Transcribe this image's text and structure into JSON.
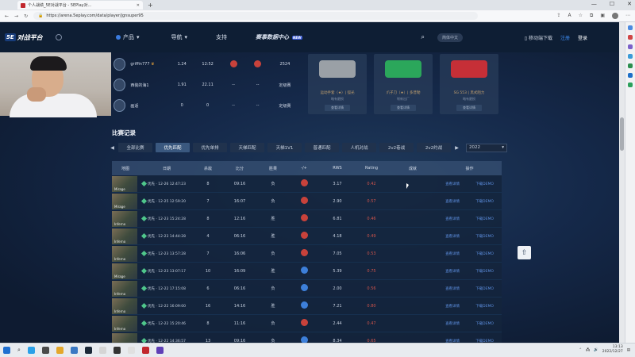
{
  "browser": {
    "tab_title": "个人战绩_5E对战平台 - 5EPlay对...",
    "url": "https://arena.5eplay.com/data/player/jgnsuper95"
  },
  "site_nav": {
    "logo_text": "对战平台",
    "logo_badge": "5E",
    "items": [
      "产品",
      "导航",
      "支持"
    ],
    "event_label": "赛事数据中心",
    "event_badge": "NEW",
    "language": "简体中文",
    "download": "移动端下载",
    "register": "注册",
    "login": "登录"
  },
  "teammates": [
    {
      "name": "griffin777",
      "v1": "1.24",
      "v2": "12:52",
      "v3": "",
      "v4": "",
      "v5": "2524"
    },
    {
      "name": "西装的海1",
      "v1": "1.91",
      "v2": "22.11",
      "v3": "--",
      "v4": "--",
      "v5": "定级赛"
    },
    {
      "name": "画适",
      "v1": "0",
      "v2": "0",
      "v3": "--",
      "v4": "--",
      "v5": "定级赛"
    }
  ],
  "weapons": [
    {
      "name": "运动手套（★）| 弧光",
      "sub": "略有磨损",
      "action": "查看详情",
      "color": "#9aa0a6"
    },
    {
      "name": "爪子刀（★）| 多普勒",
      "sub": "崭新出厂",
      "action": "查看详情",
      "color": "#2ba75b"
    },
    {
      "name": "SG 553 | 黑式阻力",
      "sub": "略有磨损",
      "action": "查看详情",
      "color": "#c62f37"
    }
  ],
  "section_title": "比赛记录",
  "filters": {
    "tabs": [
      "全部比赛",
      "优先匹配",
      "优先单排",
      "天梯匹配",
      "天梯1V1",
      "普通匹配",
      "人机对战",
      "2v2巷战",
      "2v2约战"
    ],
    "active": "优先匹配",
    "year": "2022"
  },
  "table": {
    "headers": [
      "地图",
      "日期",
      "杀敌",
      "比分",
      "胜果",
      "-/+",
      "RWS",
      "Rating",
      "成就",
      "操作"
    ],
    "rows": [
      {
        "map": "Mirage",
        "date": "优先 · 12-26 12:47:23",
        "kills": "8",
        "score": "09:16",
        "result": "负",
        "badge": "red",
        "rws": "3.17",
        "rating": "0.42",
        "op1": "查看详情",
        "op2": "下载DEMO"
      },
      {
        "map": "Mirage",
        "date": "优先 · 12-25 12:59:20",
        "kills": "7",
        "score": "16:07",
        "result": "负",
        "badge": "red",
        "rws": "2.90",
        "rating": "0.57",
        "op1": "查看详情",
        "op2": "下载DEMO"
      },
      {
        "map": "Inferno",
        "date": "优先 · 12-23 15:24:28",
        "kills": "8",
        "score": "12:16",
        "result": "胜",
        "badge": "red",
        "rws": "6.81",
        "rating": "0.46",
        "op1": "查看详情",
        "op2": "下载DEMO"
      },
      {
        "map": "Inferno",
        "date": "优先 · 12-23 14:44:28",
        "kills": "4",
        "score": "06:16",
        "result": "胜",
        "badge": "red",
        "rws": "4.18",
        "rating": "0.49",
        "op1": "查看详情",
        "op2": "下载DEMO"
      },
      {
        "map": "Inferno",
        "date": "优先 · 12-23 13:57:28",
        "kills": "7",
        "score": "16:06",
        "result": "负",
        "badge": "red",
        "rws": "7.05",
        "rating": "0.53",
        "op1": "查看详情",
        "op2": "下载DEMO"
      },
      {
        "map": "Mirage",
        "date": "优先 · 12-23 13:07:17",
        "kills": "10",
        "score": "16:09",
        "result": "胜",
        "badge": "blue",
        "rws": "5.39",
        "rating": "0.75",
        "op1": "查看详情",
        "op2": "下载DEMO"
      },
      {
        "map": "Inferno",
        "date": "优先 · 12-22 17:15:08",
        "kills": "6",
        "score": "06:16",
        "result": "负",
        "badge": "blue",
        "rws": "2.00",
        "rating": "0.56",
        "op1": "查看详情",
        "op2": "下载DEMO"
      },
      {
        "map": "Inferno",
        "date": "优先 · 12-22 16:09:00",
        "kills": "16",
        "score": "14:16",
        "result": "胜",
        "badge": "blue",
        "rws": "7.21",
        "rating": "0.80",
        "op1": "查看详情",
        "op2": "下载DEMO"
      },
      {
        "map": "Inferno",
        "date": "优先 · 12-22 15:20:46",
        "kills": "8",
        "score": "11:16",
        "result": "负",
        "badge": "red",
        "rws": "2.44",
        "rating": "0.47",
        "op1": "查看详情",
        "op2": "下载DEMO"
      },
      {
        "map": "Inferno",
        "date": "优先 · 12-22 14:36:57",
        "kills": "13",
        "score": "09:16",
        "result": "负",
        "badge": "blue",
        "rws": "8.34",
        "rating": "0.65",
        "op1": "查看详情",
        "op2": "下载DEMO"
      }
    ]
  },
  "taskbar": {
    "time": "13:13",
    "date": "2022/12/27"
  }
}
